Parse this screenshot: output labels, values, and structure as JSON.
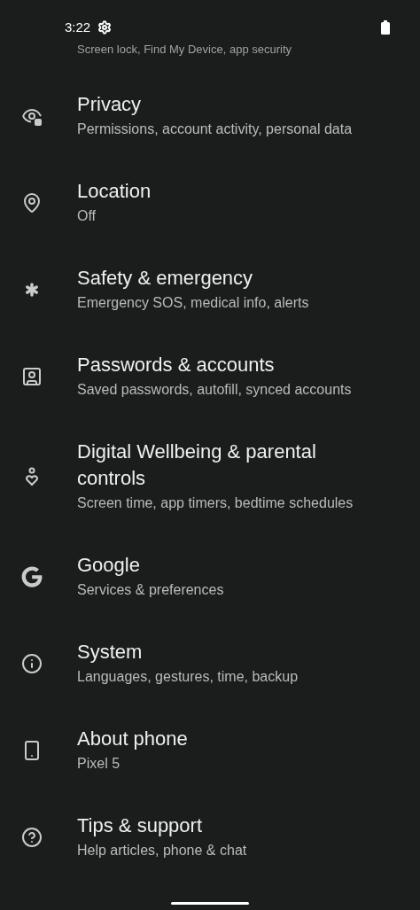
{
  "status_bar": {
    "time": "3:22"
  },
  "partial_item": {
    "subtitle": "Screen lock, Find My Device, app security"
  },
  "items": [
    {
      "title": "Privacy",
      "subtitle": "Permissions, account activity, personal data"
    },
    {
      "title": "Location",
      "subtitle": "Off"
    },
    {
      "title": "Safety & emergency",
      "subtitle": "Emergency SOS, medical info, alerts"
    },
    {
      "title": "Passwords & accounts",
      "subtitle": "Saved passwords, autofill, synced accounts"
    },
    {
      "title": "Digital Wellbeing & parental controls",
      "subtitle": "Screen time, app timers, bedtime schedules"
    },
    {
      "title": "Google",
      "subtitle": "Services & preferences"
    },
    {
      "title": "System",
      "subtitle": "Languages, gestures, time, backup"
    },
    {
      "title": "About phone",
      "subtitle": "Pixel 5"
    },
    {
      "title": "Tips & support",
      "subtitle": "Help articles, phone & chat"
    }
  ]
}
